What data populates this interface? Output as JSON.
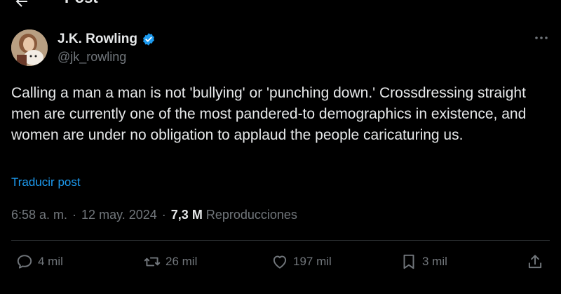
{
  "header": {
    "title": "Post"
  },
  "author": {
    "display_name": "J.K. Rowling",
    "handle": "@jk_rowling",
    "verified": true
  },
  "post": {
    "text": "Calling a man a man is not 'bullying' or 'punching down.' Crossdressing straight men are currently one of the most pandered-to demographics in existence, and women are under no obligation to applaud the people caricaturing us.",
    "translate_label": "Traducir post"
  },
  "meta": {
    "time": "6:58 a. m.",
    "separator": "·",
    "date": "12 may. 2024",
    "views": "7,3 M",
    "views_label": "Reproducciones"
  },
  "actions": {
    "replies": "4 mil",
    "reposts": "26 mil",
    "likes": "197 mil",
    "bookmarks": "3 mil"
  },
  "colors": {
    "background": "#000000",
    "text": "#e7e9ea",
    "muted": "#71767b",
    "accent": "#1d9bf0",
    "divider": "#2f3336"
  }
}
